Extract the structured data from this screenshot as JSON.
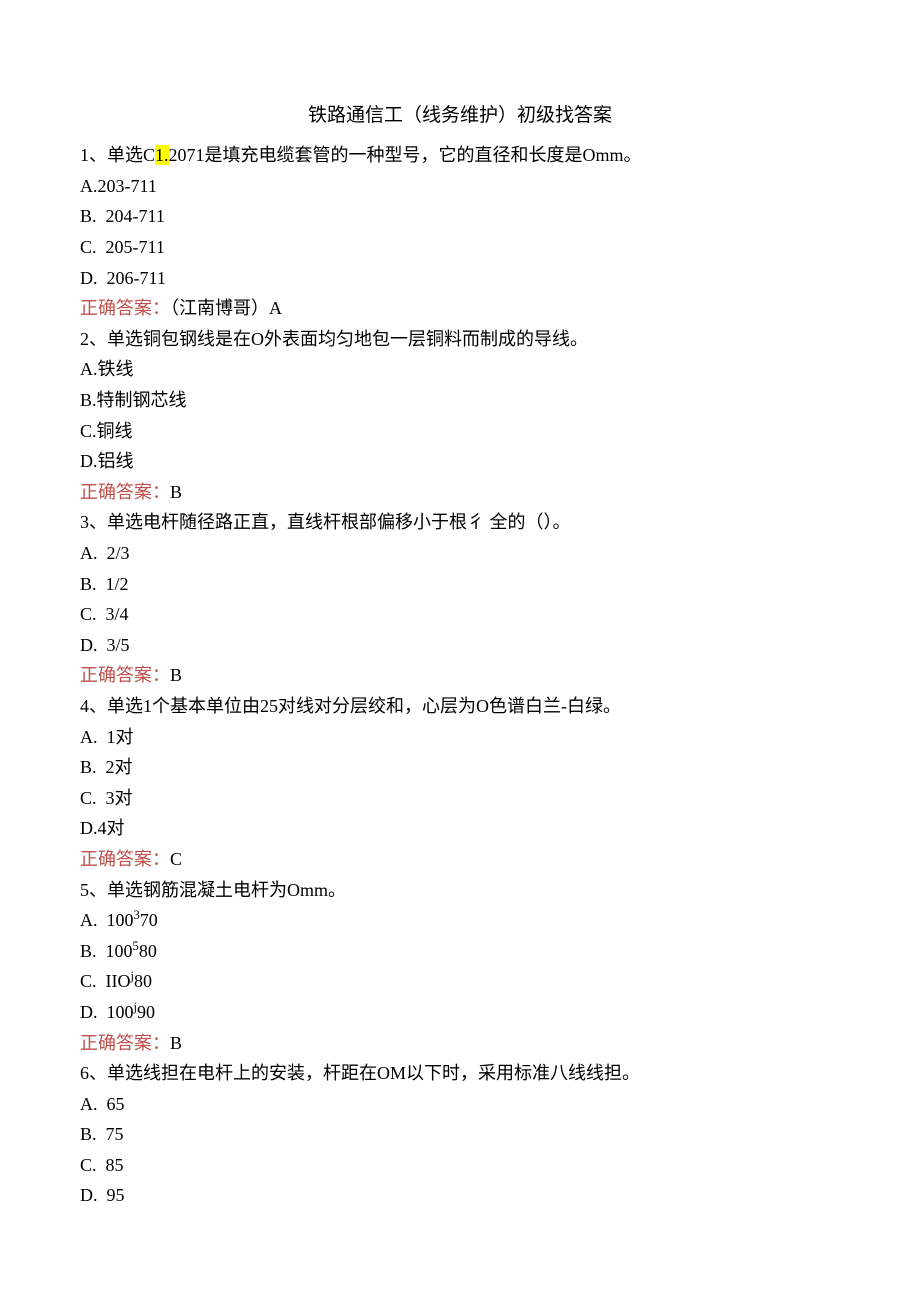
{
  "title": "铁路通信工（线务维护）初级找答案",
  "answer_label": "正确答案：",
  "questions": [
    {
      "num": "1、",
      "type": "单选",
      "stem_prefix": "C",
      "stem_highlight": "1.",
      "stem_suffix": "2071是填充电缆套管的一种型号，它的直径和长度是Omm。",
      "options": [
        {
          "label": "A.",
          "text": "203-711"
        },
        {
          "label": "B.",
          "text": "204-711",
          "spaced": true
        },
        {
          "label": "C.",
          "text": "205-711",
          "spaced": true
        },
        {
          "label": "D.",
          "text": "206-711",
          "spaced": true
        }
      ],
      "answer": "（江南博哥）A"
    },
    {
      "num": "2、",
      "type": "单选",
      "stem": "铜包钢线是在O外表面均匀地包一层铜料而制成的导线。",
      "options": [
        {
          "label": "A.",
          "text": "铁线"
        },
        {
          "label": "B.",
          "text": "特制钢芯线"
        },
        {
          "label": "C.",
          "text": "铜线"
        },
        {
          "label": "D.",
          "text": "铝线"
        }
      ],
      "answer": "B"
    },
    {
      "num": "3、",
      "type": "单选",
      "stem": "电杆随径路正直，直线杆根部偏移小于根彳 全的（）。",
      "options": [
        {
          "label": "A.",
          "text": "2/3",
          "spaced": true
        },
        {
          "label": "B.",
          "text": "1/2",
          "spaced": true
        },
        {
          "label": "C.",
          "text": "3/4",
          "spaced": true
        },
        {
          "label": "D.",
          "text": "3/5",
          "spaced": true
        }
      ],
      "answer": "B"
    },
    {
      "num": "4、",
      "type": "单选",
      "stem": "1个基本单位由25对线对分层绞和，心层为O色谱白兰-白绿。",
      "options": [
        {
          "label": "A.",
          "text": "1对",
          "spaced": true
        },
        {
          "label": "B.",
          "text": "2对",
          "spaced": true
        },
        {
          "label": "C.",
          "text": "3对",
          "spaced": true
        },
        {
          "label": "D.",
          "text": "4对"
        }
      ],
      "answer": "C"
    },
    {
      "num": "5、",
      "type": "单选",
      "stem": "钢筋混凝土电杆为Omm。",
      "options": [
        {
          "label": "A.",
          "text_pre": "100",
          "text_sup": "3",
          "text_post": "70",
          "spaced": true
        },
        {
          "label": "B.",
          "text_pre": "100",
          "text_sup": "5",
          "text_post": "80",
          "spaced": true
        },
        {
          "label": "C.",
          "text_pre": "IIO",
          "text_sup": "j",
          "text_post": "80",
          "spaced": true
        },
        {
          "label": "D.",
          "text_pre": "100",
          "text_sup": "j",
          "text_post": "90",
          "spaced": true
        }
      ],
      "answer": "B"
    },
    {
      "num": "6、",
      "type": "单选",
      "stem": "线担在电杆上的安装，杆距在OM以下时，采用标准八线线担。",
      "options": [
        {
          "label": "A.",
          "text": "65",
          "spaced": true
        },
        {
          "label": "B.",
          "text": "75",
          "spaced": true
        },
        {
          "label": "C.",
          "text": "85",
          "spaced": true
        },
        {
          "label": "D.",
          "text": "95",
          "spaced": true
        }
      ]
    }
  ]
}
